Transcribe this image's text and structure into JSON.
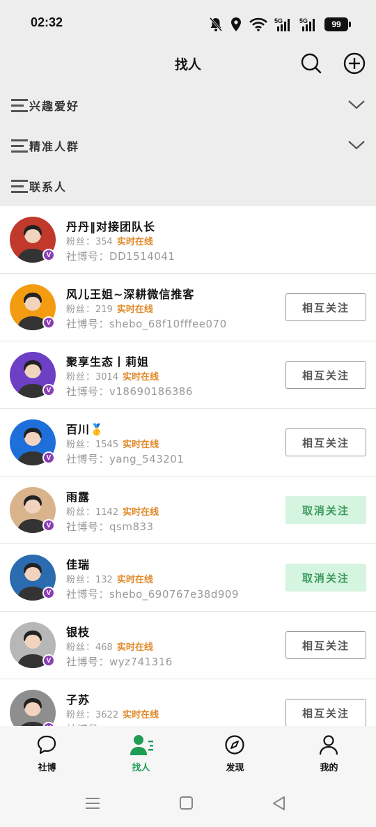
{
  "status_bar": {
    "time": "02:32",
    "battery": "99",
    "net1": "5G",
    "net2": "5G"
  },
  "header": {
    "title": "找人",
    "search_icon": "search-icon",
    "add_icon": "plus-circle-icon"
  },
  "filters": [
    {
      "label": "兴趣爱好",
      "expandable": true
    },
    {
      "label": "精准人群",
      "expandable": true
    },
    {
      "label": "联系人",
      "expandable": false
    }
  ],
  "users": [
    {
      "name": "丹丹‖对接团队长",
      "fans_label": "粉丝：",
      "fans": "354",
      "status": "实时在线",
      "account_label": "社博号：",
      "account": "DD1514041",
      "button": "",
      "avatar_color": "#c0392b"
    },
    {
      "name": "风儿王姐~深耕微信推客",
      "fans_label": "粉丝：",
      "fans": "219",
      "status": "实时在线",
      "account_label": "社博号：",
      "account": "shebo_68f10fffee070",
      "button": "相互关注",
      "button_type": "follow",
      "avatar_color": "#f39c12"
    },
    {
      "name": "聚享生态丨莉姐",
      "fans_label": "粉丝：",
      "fans": "3014",
      "status": "实时在线",
      "account_label": "社博号：",
      "account": "v18690186386",
      "button": "相互关注",
      "button_type": "follow",
      "avatar_color": "#6c3fc5"
    },
    {
      "name": "百川🥇",
      "fans_label": "粉丝：",
      "fans": "1545",
      "status": "实时在线",
      "account_label": "社博号：",
      "account": "yang_543201",
      "button": "相互关注",
      "button_type": "follow",
      "avatar_color": "#1e6fd9"
    },
    {
      "name": "雨露",
      "fans_label": "粉丝：",
      "fans": "1142",
      "status": "实时在线",
      "account_label": "社博号：",
      "account": "qsm833",
      "button": "取消关注",
      "button_type": "unfollow",
      "avatar_color": "#d9b38c"
    },
    {
      "name": "佳瑞",
      "fans_label": "粉丝：",
      "fans": "132",
      "status": "实时在线",
      "account_label": "社博号：",
      "account": "shebo_690767e38d909",
      "button": "取消关注",
      "button_type": "unfollow",
      "avatar_color": "#2b6cb0"
    },
    {
      "name": "银枝",
      "fans_label": "粉丝：",
      "fans": "468",
      "status": "实时在线",
      "account_label": "社博号：",
      "account": "wyz741316",
      "button": "相互关注",
      "button_type": "follow",
      "avatar_color": "#b7b7b7"
    },
    {
      "name": "子苏",
      "fans_label": "粉丝：",
      "fans": "3622",
      "status": "实时在线",
      "account_label": "社博号：",
      "account": "",
      "button": "相互关注",
      "button_type": "follow",
      "avatar_color": "#8e8e8e"
    }
  ],
  "tabs": [
    {
      "label": "社博",
      "icon": "chat-bubble-icon",
      "active": false
    },
    {
      "label": "找人",
      "icon": "find-people-icon",
      "active": true
    },
    {
      "label": "发现",
      "icon": "compass-icon",
      "active": false
    },
    {
      "label": "我的",
      "icon": "person-icon",
      "active": false
    }
  ],
  "colors": {
    "accent": "#1f9d55",
    "online": "#e0892a",
    "badge": "#8a3db6",
    "unfollow_bg": "#d6f5e1"
  }
}
